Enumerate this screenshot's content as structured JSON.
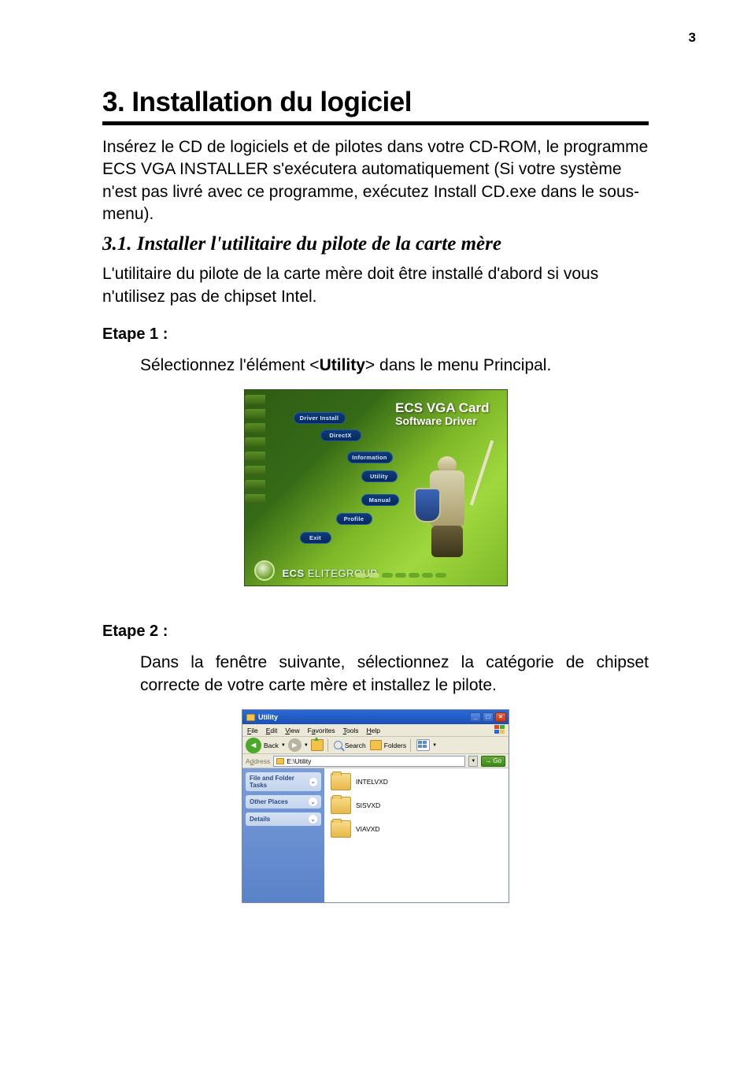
{
  "page_number": "3",
  "main_title": "3. Installation du logiciel",
  "intro": "Insérez le CD de logiciels et de pilotes dans votre CD-ROM, le programme ECS VGA INSTALLER s'exécutera automatiquement (Si votre système n'est pas livré avec ce programme, exécutez Install CD.exe dans le sous-menu).",
  "section_title": "3.1. Installer l'utilitaire du pilote de la carte mère",
  "section_intro": "L'utilitaire du pilote de la carte mère doit être installé d'abord si vous n'utilisez pas de chipset Intel.",
  "step1_label": "Etape 1 :",
  "step1_pre": "Sélectionnez l'élément <",
  "step1_bold": "Utility",
  "step1_post": "> dans le menu Principal.",
  "installer": {
    "title_line1": "ECS VGA Card",
    "title_line2": "Software Driver",
    "btn_driver": "Driver Install",
    "btn_directx": "DirectX",
    "btn_info": "Information",
    "btn_utility": "Utility",
    "btn_manual": "Manual",
    "btn_profile": "Profile",
    "btn_exit": "Exit",
    "brand_ecs": "ECS",
    "brand_elite": " ELITEGROUP"
  },
  "step2_label": "Etape 2 :",
  "step2_text": "Dans la fenêtre suivante, sélectionnez la catégorie de chipset correcte de votre carte mère et installez le pilote.",
  "explorer": {
    "title": "Utility",
    "menu": {
      "file": "File",
      "edit": "Edit",
      "view": "View",
      "favorites": "Favorites",
      "tools": "Tools",
      "help": "Help"
    },
    "toolbar": {
      "back": "Back",
      "search": "Search",
      "folders": "Folders"
    },
    "addr_label": "Address",
    "addr_value": "E:\\Utility",
    "go": "Go",
    "side": {
      "tasks": "File and Folder Tasks",
      "other": "Other Places",
      "details": "Details"
    },
    "folders": [
      "INTELVXD",
      "SISVXD",
      "VIAVXD"
    ]
  }
}
